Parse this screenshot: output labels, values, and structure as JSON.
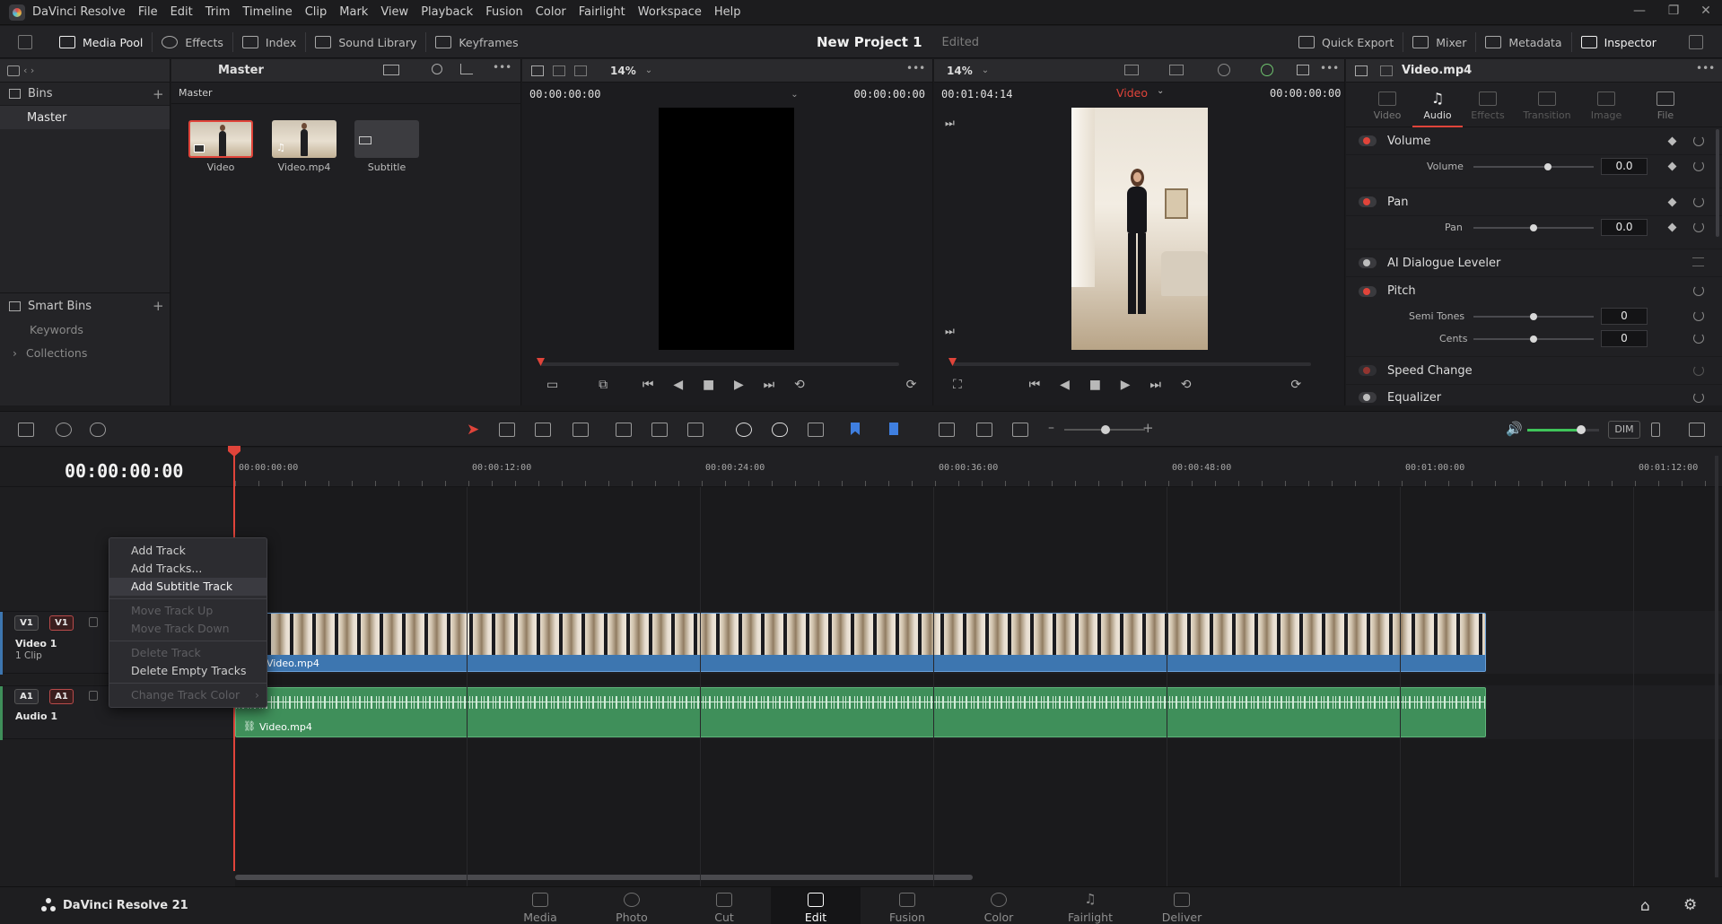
{
  "menubar": {
    "app": "DaVinci Resolve",
    "items": [
      "File",
      "Edit",
      "Trim",
      "Timeline",
      "Clip",
      "Mark",
      "View",
      "Playback",
      "Fusion",
      "Color",
      "Fairlight",
      "Workspace",
      "Help"
    ]
  },
  "toolbar": {
    "media_pool": "Media Pool",
    "effects": "Effects",
    "index": "Index",
    "sound_library": "Sound Library",
    "keyframes": "Keyframes",
    "project_title": "New Project 1",
    "project_status": "Edited",
    "quick_export": "Quick Export",
    "mixer": "Mixer",
    "metadata": "Metadata",
    "inspector": "Inspector"
  },
  "bins": {
    "header": "Bins",
    "master": "Master",
    "smart_bins": "Smart Bins",
    "keywords": "Keywords",
    "collections": "Collections"
  },
  "mediapool": {
    "breadcrumb": "Master",
    "clips": [
      {
        "label": "Video",
        "kind": "timeline"
      },
      {
        "label": "Video.mp4",
        "kind": "video"
      },
      {
        "label": "Subtitle",
        "kind": "subtitle"
      }
    ]
  },
  "source_viewer": {
    "zoom": "14%",
    "timecode_left": "00:00:00:00",
    "timecode_right": "00:00:00:00"
  },
  "timeline_viewer": {
    "zoom": "14%",
    "timecode_left": "00:01:04:14",
    "selector": "Video",
    "timecode_right": "00:00:00:00"
  },
  "inspector": {
    "clip_name": "Video.mp4",
    "tabs": [
      "Video",
      "Audio",
      "Effects",
      "Transition",
      "Image",
      "File"
    ],
    "active_tab": "Audio",
    "sections": {
      "volume": {
        "title": "Volume",
        "prop": "Volume",
        "value": "0.0",
        "level": 0.62
      },
      "pan": {
        "title": "Pan",
        "prop": "Pan",
        "value": "0.0",
        "level": 0.5
      },
      "dialogue": {
        "title": "AI Dialogue Leveler"
      },
      "pitch": {
        "title": "Pitch",
        "semi_label": "Semi Tones",
        "semi_value": "0",
        "cents_label": "Cents",
        "cents_value": "0"
      },
      "speed": {
        "title": "Speed Change"
      },
      "eq": {
        "title": "Equalizer"
      }
    }
  },
  "timeline": {
    "timecode": "00:00:00:00",
    "ruler": [
      "00:00:00:00",
      "00:00:12:00",
      "00:00:24:00",
      "00:00:36:00",
      "00:00:48:00",
      "00:01:00:00",
      "00:01:12:00"
    ],
    "dim": "DIM",
    "tracks": {
      "v1": {
        "btn1": "V1",
        "btn2": "V1",
        "name": "Video 1",
        "info": "1 Clip",
        "clip": "Video.mp4"
      },
      "a1": {
        "btn1": "A1",
        "btn2": "A1",
        "name": "Audio 1",
        "clip": "Video.mp4"
      }
    },
    "audio_level": 0.75
  },
  "context_menu": {
    "items": [
      {
        "label": "Add Track",
        "state": "normal"
      },
      {
        "label": "Add Tracks...",
        "state": "normal"
      },
      {
        "label": "Add Subtitle Track",
        "state": "highlighted"
      },
      {
        "label": "Move Track Up",
        "state": "disabled"
      },
      {
        "label": "Move Track Down",
        "state": "disabled"
      },
      {
        "label": "Delete Track",
        "state": "disabled"
      },
      {
        "label": "Delete Empty Tracks",
        "state": "normal"
      },
      {
        "label": "Change Track Color",
        "state": "disabled"
      }
    ]
  },
  "bottombar": {
    "product": "DaVinci Resolve 21",
    "pages": [
      "Media",
      "Photo",
      "Cut",
      "Edit",
      "Fusion",
      "Color",
      "Fairlight",
      "Deliver"
    ],
    "active_page": "Edit"
  },
  "colors": {
    "accent_red": "#e0443a",
    "video_track_blue": "#3d76b0",
    "audio_track_green": "#3f8f5a",
    "level_green": "#3fc45a"
  }
}
